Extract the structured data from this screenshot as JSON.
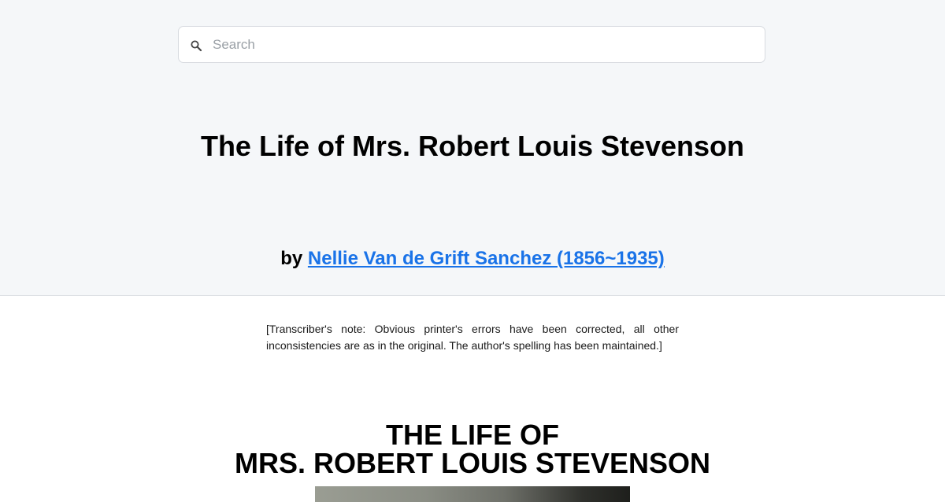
{
  "search": {
    "placeholder": "Search",
    "icon": "search-icon"
  },
  "book": {
    "title": "The Life of Mrs. Robert Louis Stevenson",
    "by_prefix": "by",
    "author_link": "Nellie Van de Grift Sanchez (1856~1935)"
  },
  "content": {
    "transcriber_note": "[Transcriber's note: Obvious printer's errors have been corrected, all other inconsistencies are as in the original. The author's spelling has been maintained.]",
    "heading_line1": "THE LIFE OF",
    "heading_line2": "MRS. ROBERT LOUIS STEVENSON"
  },
  "colors": {
    "header_bg": "#f5f7f9",
    "link": "#1a73e8"
  }
}
